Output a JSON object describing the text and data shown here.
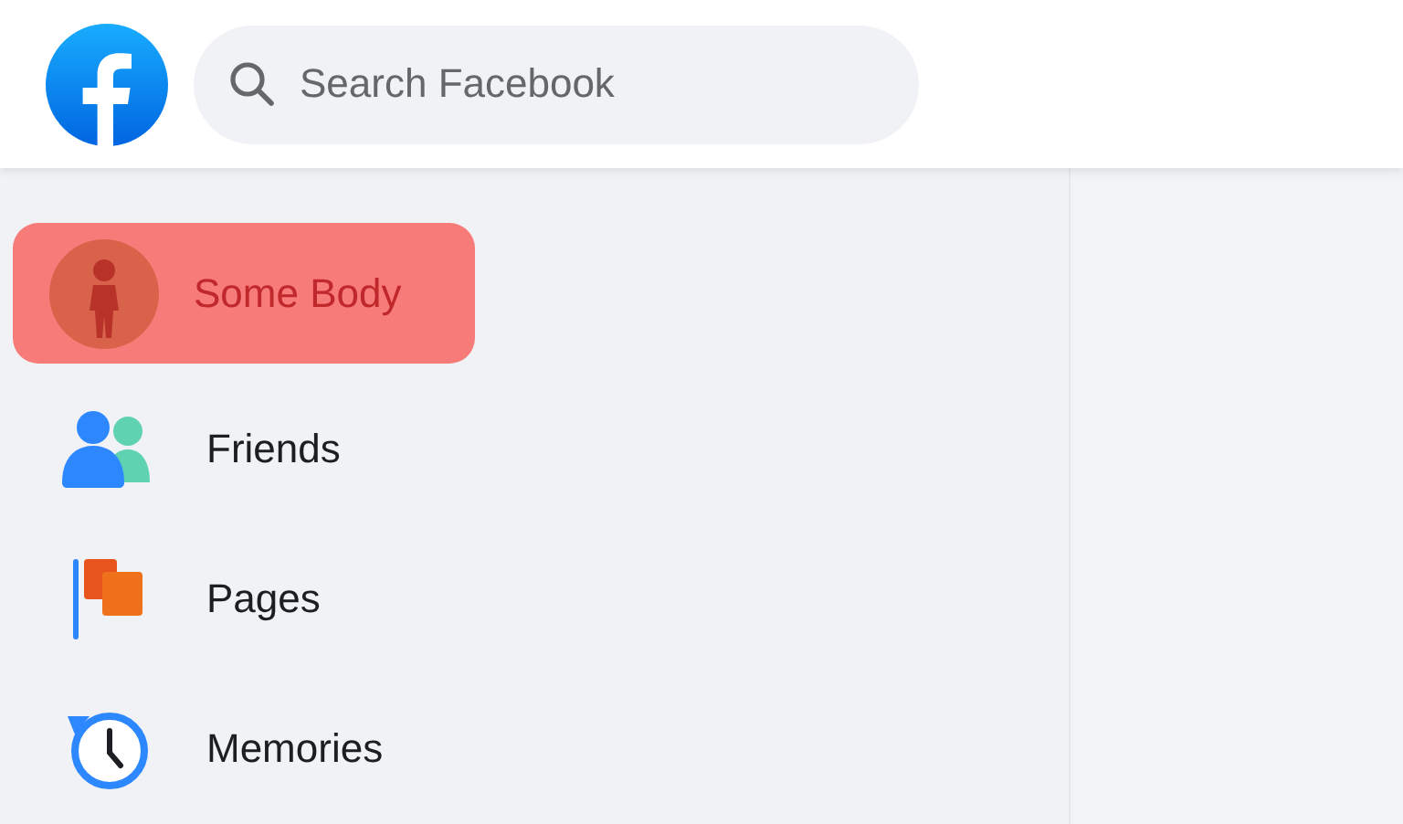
{
  "search": {
    "placeholder": "Search Facebook"
  },
  "sidebar": {
    "items": [
      {
        "kind": "profile",
        "label": "Some Body",
        "highlighted": true
      },
      {
        "kind": "friends",
        "label": "Friends",
        "highlighted": false
      },
      {
        "kind": "pages",
        "label": "Pages",
        "highlighted": false
      },
      {
        "kind": "memories",
        "label": "Memories",
        "highlighted": false
      }
    ]
  }
}
